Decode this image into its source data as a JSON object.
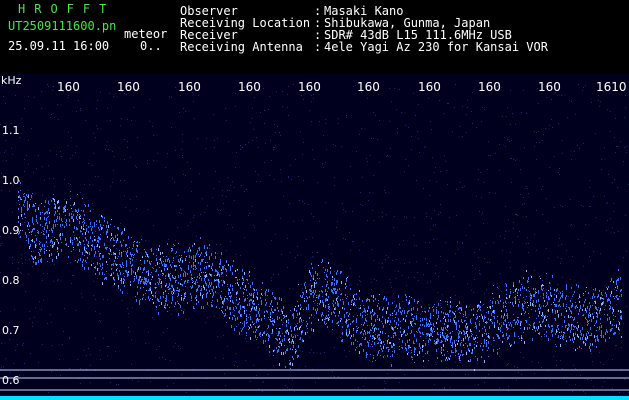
{
  "header": {
    "title": "HROFFT",
    "filename": "UT2509111600.pn",
    "tag": "meteor",
    "datetime": "25.09.11 16:00",
    "dots": "0..",
    "meta": [
      {
        "key": "Observer",
        "sep": ":",
        "value": "Masaki Kano"
      },
      {
        "key": "Receiving Location",
        "sep": ":",
        "value": "Shibukawa, Gunma, Japan"
      },
      {
        "key": "Receiver",
        "sep": ":",
        "value": "SDR# 43dB L15 111.6MHz USB"
      },
      {
        "key": "Receiving Antenna",
        "sep": ":",
        "value": "4ele Yagi Az 230 for Kansai VOR"
      }
    ]
  },
  "axis": {
    "unit": "kHz",
    "y_ticks": [
      "1.1",
      "1.0",
      "0.9",
      "0.8",
      "0.7",
      "0.6"
    ],
    "x_ticks": [
      "160",
      "160",
      "160",
      "160",
      "160",
      "160",
      "160",
      "160",
      "160",
      "1610"
    ]
  },
  "colors": {
    "background": "#00001e",
    "signal": "#3a6cff",
    "signal_bright": "#8fb4ff",
    "baseline": "#00e0ff",
    "grid_line": "#c8d4ff"
  }
}
